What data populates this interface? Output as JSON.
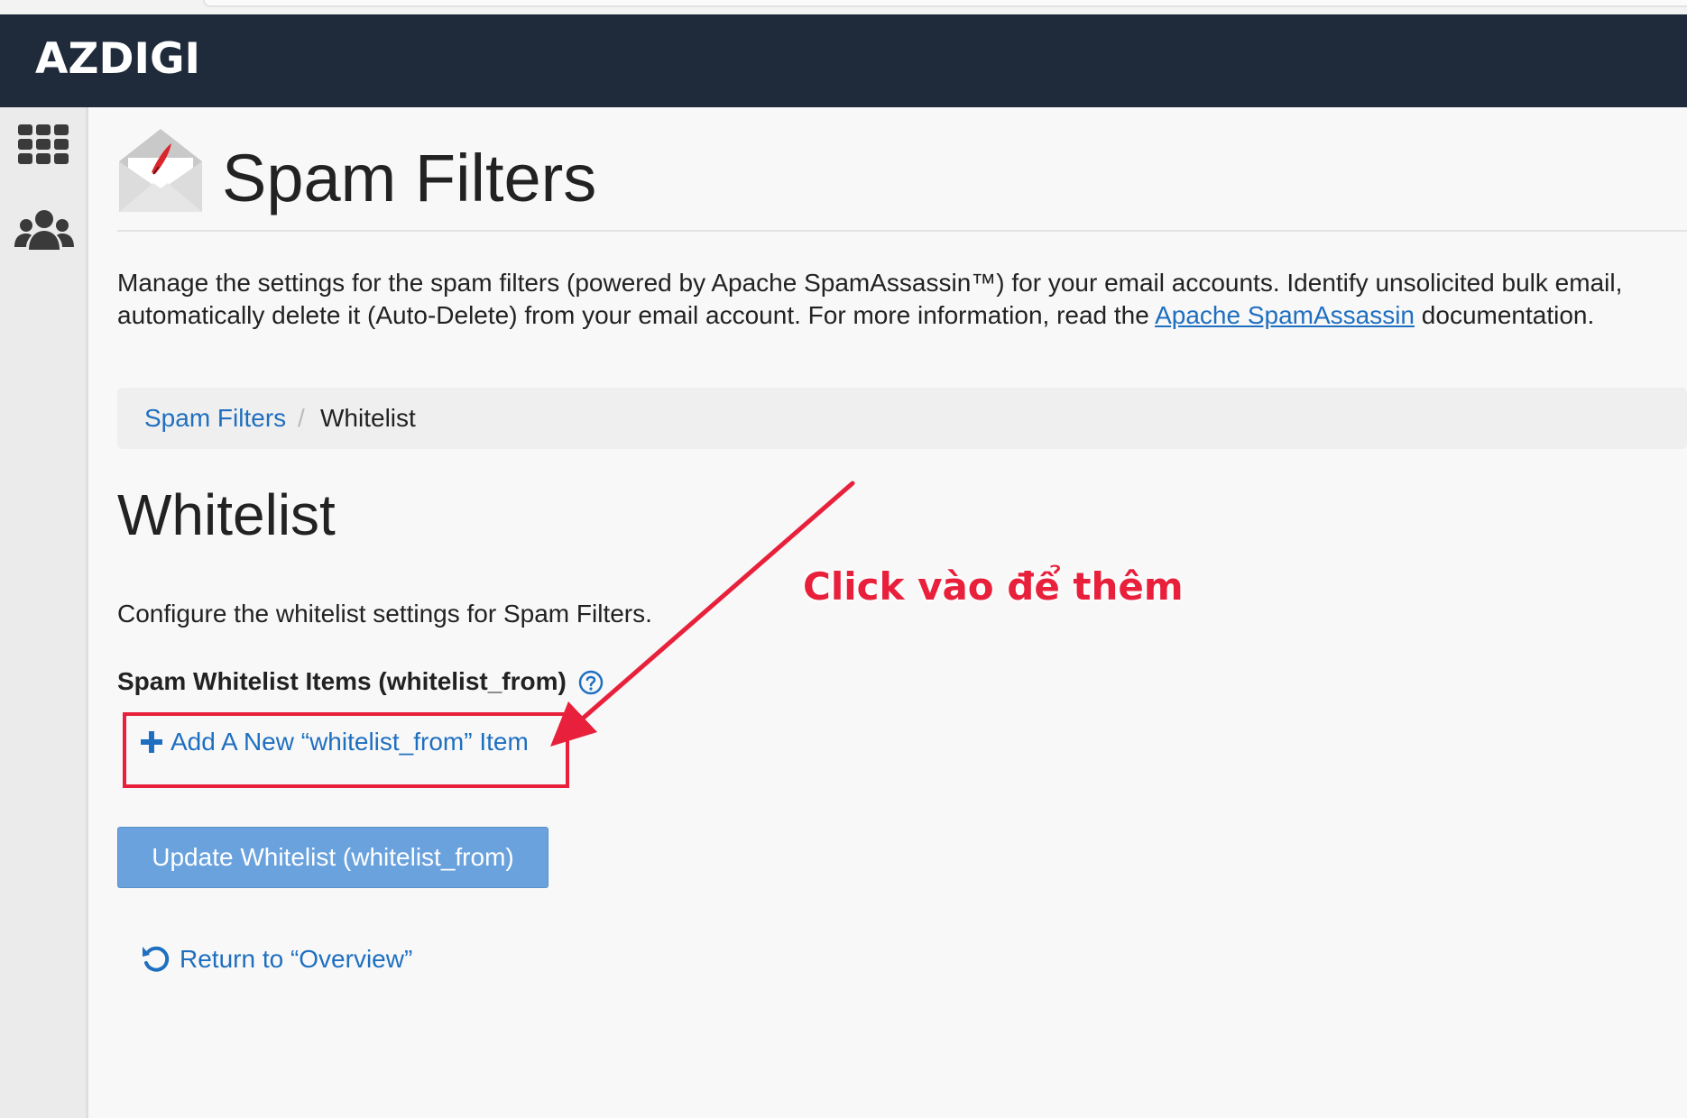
{
  "brand": {
    "name": "AZDIGI"
  },
  "sidebar": {
    "icons": [
      {
        "icon": "grid-icon"
      },
      {
        "icon": "users-icon"
      }
    ]
  },
  "header": {
    "title": "Spam Filters",
    "icon": "spam-filters-envelope-icon"
  },
  "description": {
    "line1": "Manage the settings for the spam filters (powered by Apache SpamAssassin™) for your email accounts. Identify unsolicited bulk email,",
    "line2_before": "automatically delete it (Auto-Delete) from your email account. For more information, read the ",
    "link_text": "Apache SpamAssassin",
    "line2_after": " documentation."
  },
  "breadcrumb": {
    "parent": "Spam Filters",
    "separator": "/",
    "current": "Whitelist"
  },
  "whitelist": {
    "title": "Whitelist",
    "description": "Configure the whitelist settings for Spam Filters.",
    "items_label": "Spam Whitelist Items (whitelist_from)",
    "add_link": "Add A New “whitelist_from” Item",
    "update_button": "Update Whitelist (whitelist_from)",
    "return_link": "Return to “Overview”"
  },
  "annotation": {
    "text": "Click vào để thêm",
    "color": "#e8203b"
  },
  "colors": {
    "topbar": "#1f2a3a",
    "link": "#1f6fc0",
    "button": "#6aa2dd"
  }
}
